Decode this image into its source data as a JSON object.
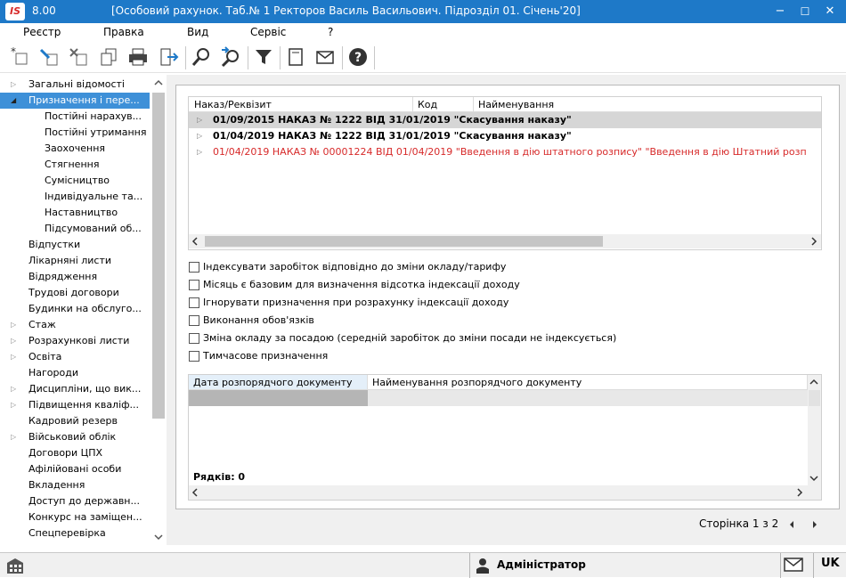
{
  "app": {
    "version": "8.00",
    "title": "[Особовий рахунок. Таб.№ 1 Ректоров Василь Васильович. Підрозділ 01. Січень'20]",
    "logo": "IS",
    "colors": {
      "accent": "#1e79c8",
      "selected": "#3e90d8",
      "red_row": "#d72a2a"
    }
  },
  "window_controls": {
    "minimize": "−",
    "maximize": "☐",
    "close": "✕"
  },
  "menu": [
    "Реєстр",
    "Правка",
    "Вид",
    "Сервіс",
    "?"
  ],
  "toolbar": [
    "add-icon",
    "edit-icon",
    "delete-icon",
    "copy-icon",
    "print-icon",
    "exit-icon",
    "find-icon",
    "find-next-icon",
    "filter-icon",
    "document-icon",
    "mail-icon",
    "help-icon"
  ],
  "sidebar": [
    {
      "label": "Загальні відомості",
      "expander": "▷"
    },
    {
      "label": "Призначення і пере...",
      "expander": "◢",
      "selected": true
    },
    {
      "label": "Постійні нарахув..."
    },
    {
      "label": "Постійні утримання"
    },
    {
      "label": "Заохочення"
    },
    {
      "label": "Стягнення"
    },
    {
      "label": "Сумісництво"
    },
    {
      "label": "Індивідуальне та..."
    },
    {
      "label": "Наставництво"
    },
    {
      "label": "Підсумований об..."
    },
    {
      "label": "Відпустки"
    },
    {
      "label": "Лікарняні листи"
    },
    {
      "label": "Відрядження"
    },
    {
      "label": "Трудові договори"
    },
    {
      "label": "Будинки на обслуго..."
    },
    {
      "label": "Стаж",
      "expander": "▷"
    },
    {
      "label": "Розрахункові листи",
      "expander": "▷"
    },
    {
      "label": "Освіта",
      "expander": "▷"
    },
    {
      "label": "Нагороди"
    },
    {
      "label": "Дисципліни, що вик...",
      "expander": "▷"
    },
    {
      "label": "Підвищення кваліф...",
      "expander": "▷"
    },
    {
      "label": "Кадровий резерв"
    },
    {
      "label": "Військовий облік",
      "expander": "▷"
    },
    {
      "label": "Договори ЦПХ"
    },
    {
      "label": "Афілійовані особи"
    },
    {
      "label": "Вкладення"
    },
    {
      "label": "Доступ до державн..."
    },
    {
      "label": "Конкурс на заміщен..."
    },
    {
      "label": "Спецперевірка"
    }
  ],
  "orders": {
    "columns": [
      "Наказ/Реквізит",
      "Код",
      "Найменування"
    ],
    "rows": [
      {
        "text": "01/09/2015 НАКАЗ № 1222 ВІД 31/01/2019 \"Скасування наказу\"",
        "style": "bold-selected"
      },
      {
        "text": "01/04/2019 НАКАЗ № 1222 ВІД 31/01/2019 \"Скасування наказу\"",
        "style": "bold"
      },
      {
        "text": "01/04/2019 НАКАЗ № 00001224 ВІД 01/04/2019 \"Введення в дію штатного розпису\" \"Введення в дію Штатний розп",
        "style": "red"
      }
    ]
  },
  "checkboxes": [
    "Індексувати заробіток відповідно до зміни окладу/тарифу",
    "Місяць є базовим для визначення відсотка індексації доходу",
    "Ігнорувати призначення при розрахунку індексації доходу",
    "Виконання обов'язків",
    "Зміна окладу за посадою (середній заробіток до зміни посади не індексується)",
    "Тимчасове призначення"
  ],
  "docs": {
    "columns": [
      "Дата розпорядчого документу",
      "Найменування розпорядчого документу"
    ],
    "rows_label": "Рядків: 0"
  },
  "pager": {
    "text": "Сторінка 1 з 2"
  },
  "status": {
    "user": "Адміністратор",
    "lang": "UK"
  }
}
